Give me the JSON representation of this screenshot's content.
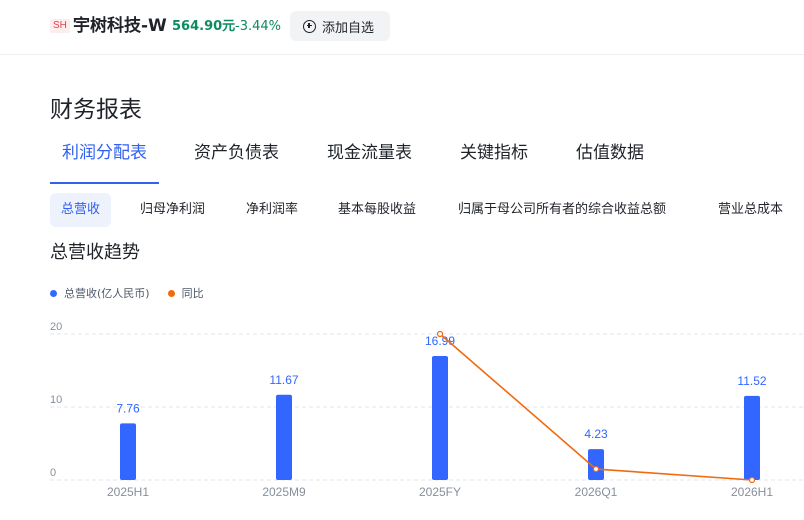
{
  "header": {
    "exchange_badge": "SH",
    "stock_name": "宇树科技-W",
    "price": "564.90元",
    "change_pct": "-3.44%",
    "watch_button_label": "添加自选",
    "watch_icon": "plus-circle-icon",
    "down_color": "#0e8a5f"
  },
  "section_title": "财务报表",
  "tabs": [
    {
      "label": "利润分配表",
      "active": true
    },
    {
      "label": "资产负债表",
      "active": false
    },
    {
      "label": "现金流量表",
      "active": false
    },
    {
      "label": "关键指标",
      "active": false
    },
    {
      "label": "估值数据",
      "active": false
    }
  ],
  "subtabs": [
    {
      "label": "总营收",
      "active": true
    },
    {
      "label": "归母净利润",
      "active": false
    },
    {
      "label": "净利润率",
      "active": false
    },
    {
      "label": "基本每股收益",
      "active": false
    },
    {
      "label": "归属于母公司所有者的综合收益总额",
      "active": false
    },
    {
      "label": "营业总成本",
      "active": false
    }
  ],
  "trend_title": "总营收趋势",
  "accent_color": "#3161f0",
  "chart_data": {
    "type": "bar",
    "categories": [
      "2025H1",
      "2025M9",
      "2025FY",
      "2026Q1",
      "2026H1"
    ],
    "series": [
      {
        "name": "总营收(亿人民币)",
        "type": "bar",
        "color": "#3366ff",
        "values": [
          7.76,
          11.67,
          16.99,
          4.23,
          11.52
        ],
        "labels": [
          "7.76",
          "11.67",
          "16.99",
          "4.23",
          "11.52"
        ]
      },
      {
        "name": "同比",
        "type": "line",
        "color": "#f06a0f",
        "values": [
          null,
          null,
          20,
          1.5,
          0
        ]
      }
    ],
    "ylim": [
      0,
      20
    ],
    "yticks": [
      "0",
      "10",
      "20"
    ],
    "grid": true,
    "legend_position": "top-left"
  }
}
